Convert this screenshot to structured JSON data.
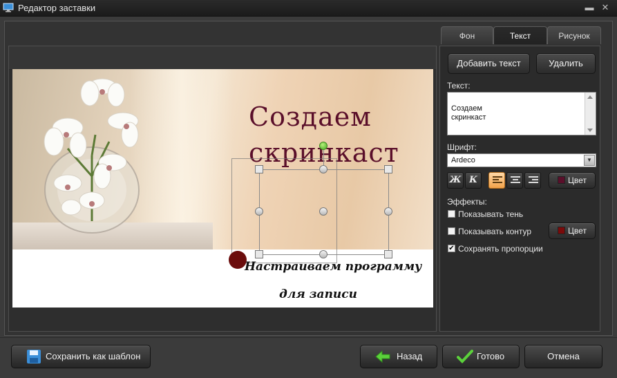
{
  "window": {
    "title": "Редактор заставки",
    "minimize": "▬",
    "close": "✕"
  },
  "tabs": [
    {
      "label": "Фон",
      "active": false
    },
    {
      "label": "Текст",
      "active": true
    },
    {
      "label": "Рисунок",
      "active": false
    }
  ],
  "panel": {
    "add_text_button": "Добавить текст",
    "delete_button": "Удалить",
    "text_label": "Текст:",
    "text_value": "Создаем\nскринкаст",
    "font_label": "Шрифт:",
    "font_value": "Ardeco",
    "bold_label": "Ж",
    "italic_label": "К",
    "align_options": [
      "left",
      "center",
      "right"
    ],
    "align_selected": "left",
    "color_button": "Цвет",
    "text_color": "#5a0f2a",
    "effects_label": "Эффекты:",
    "effects": [
      {
        "label": "Показывать тень",
        "checked": false
      },
      {
        "label": "Показывать контур",
        "checked": false
      },
      {
        "label": "Сохранять пропорции",
        "checked": true
      }
    ],
    "outline_color_button": "Цвет",
    "outline_color": "#7a0a0a"
  },
  "canvas": {
    "title_text": "Создаем\nскринкаст",
    "subtitle_line1": "Настраиваем программу",
    "subtitle_line2": "для записи",
    "dot_color": "#6b0d0d"
  },
  "footer": {
    "save_template": "Сохранить как шаблон",
    "back": "Назад",
    "done": "Готово",
    "cancel": "Отмена"
  }
}
